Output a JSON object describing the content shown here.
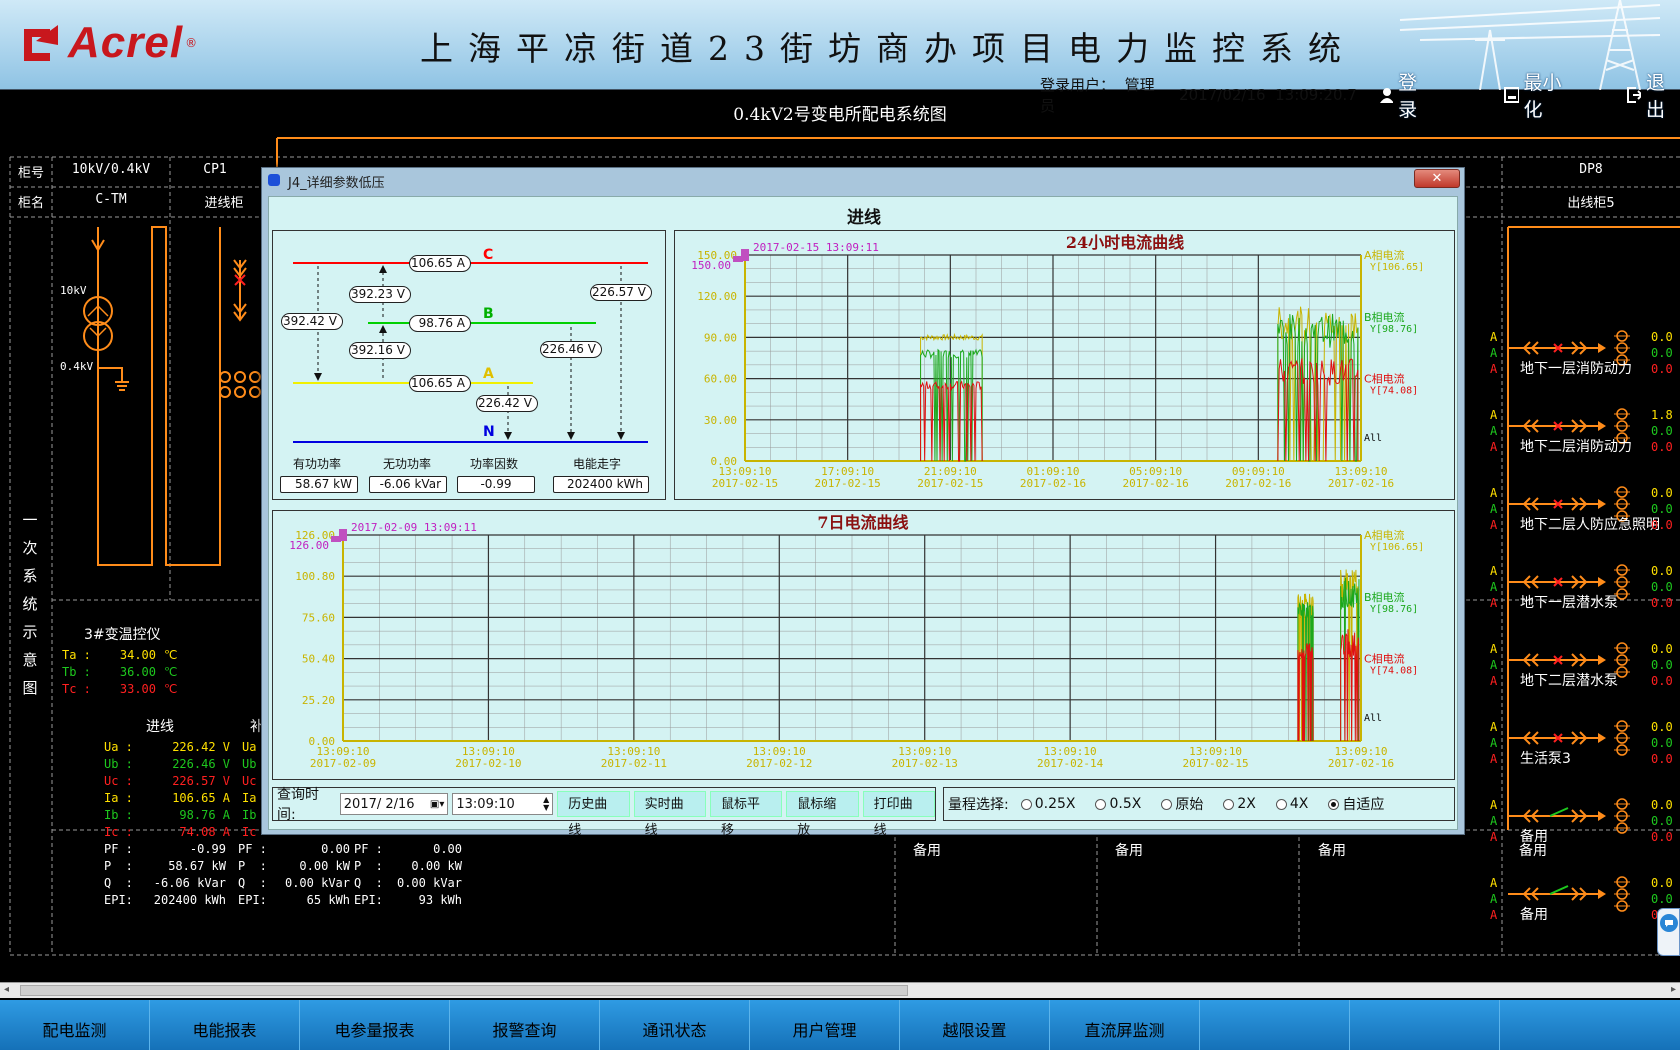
{
  "header": {
    "logo_text": "Acrel",
    "logo_reg": "®",
    "system_title": "上海平凉街道23街坊商办项目电力监控系统",
    "login_user_label": "登录用户：",
    "login_user": "管理员",
    "date": "2017/02/16",
    "time": "13:09:20.7",
    "login_button": "登录",
    "minimize_button": "最小化",
    "exit_button": "退出"
  },
  "page_title": "0.4kV2号变电所配电系统图",
  "table_header": {
    "row1_label": "柜号",
    "row2_label": "柜名",
    "col1_no": "10kV/0.4kV",
    "col1_name": "C-TM",
    "col2_no": "CP1",
    "col2_name": "进线柜",
    "col_last_no": "DP8",
    "col_last_name": "出线柜5"
  },
  "left_side": {
    "vertical_label": "一次系统示意图",
    "transformer_hv": "10kV",
    "transformer_lv": "0.4kV",
    "temp_title": "3#变温控仪",
    "temps": [
      {
        "label": "Ta :",
        "value": "34.00",
        "unit": "℃",
        "color": "#ffe000"
      },
      {
        "label": "Tb :",
        "value": "36.00",
        "unit": "℃",
        "color": "#1ec81e"
      },
      {
        "label": "Tc :",
        "value": "33.00",
        "unit": "℃",
        "color": "#ff2020"
      }
    ],
    "incoming_title": "进线",
    "incoming_title_2": "补",
    "params": [
      {
        "k": "Ua :",
        "v": "226.42 V",
        "k2": "Ua",
        "color": "#ffe000"
      },
      {
        "k": "Ub :",
        "v": "226.46 V",
        "k2": "Ub",
        "color": "#1ec81e"
      },
      {
        "k": "Uc :",
        "v": "226.57 V",
        "k2": "Uc",
        "color": "#ff2020"
      },
      {
        "k": "Ia :",
        "v": "106.65 A",
        "k2": "Ia",
        "color": "#ffe000"
      },
      {
        "k": "Ib :",
        "v": "98.76 A",
        "k2": "Ib",
        "color": "#1ec81e"
      },
      {
        "k": "Ic :",
        "v": "74.08 A",
        "k2": "Ic",
        "color": "#ff2020"
      }
    ],
    "params2": [
      {
        "k": "PF :",
        "v": "-0.99",
        "k2": "PF :",
        "v2": "0.00",
        "k3": "PF :",
        "v3": "0.00"
      },
      {
        "k": "P  :",
        "v": "58.67 kW",
        "k2": "P  :",
        "v2": "0.00 kW",
        "k3": "P  :",
        "v3": "0.00 kW"
      },
      {
        "k": "Q  :",
        "v": "-6.06 kVar",
        "k2": "Q  :",
        "v2": "0.00 kVar",
        "k3": "Q  :",
        "v3": "0.00 kVar"
      },
      {
        "k": "EPI:",
        "v": "202400 kWh",
        "k2": "EPI:",
        "v2": "65 kWh",
        "k3": "EPI:",
        "v3": "93 kWh"
      }
    ]
  },
  "right_feeders": [
    {
      "name": "地下一层消防动力",
      "vals": [
        "0.0",
        "0.0",
        "0.0"
      ]
    },
    {
      "name": "地下二层消防动力",
      "vals": [
        "1.8",
        "0.0",
        "0.0"
      ]
    },
    {
      "name": "地下二层人防应急照明",
      "vals": [
        "0.0",
        "0.0",
        "0.0"
      ]
    },
    {
      "name": "地下一层潜水泵",
      "vals": [
        "0.0",
        "0.0",
        "0.0"
      ]
    },
    {
      "name": "地下二层潜水泵",
      "vals": [
        "0.0",
        "0.0",
        "0.0"
      ]
    },
    {
      "name": "生活泵3",
      "vals": [
        "0.0",
        "0.0",
        "0.0"
      ]
    },
    {
      "name": "备用",
      "vals": [
        "0.0",
        "0.0",
        "0.0"
      ]
    },
    {
      "name": "备用",
      "vals": [
        "0.0",
        "0.0",
        "0.0"
      ]
    }
  ],
  "bottom_spare": [
    "备用",
    "备用",
    "备用",
    "备用"
  ],
  "dialog": {
    "title": "J4_详细参数低压",
    "close": "✕",
    "section_title": "进线",
    "phasor": {
      "phase_c": "C",
      "phase_b": "B",
      "phase_a": "A",
      "phase_n": "N",
      "ic": "106.65",
      "ib": "98.76",
      "ia": "106.65",
      "unit_a": "A",
      "ubc": "392.23",
      "uca": "392.42",
      "uab": "392.16",
      "unit_v": "V",
      "uc": "226.57",
      "ub": "226.46",
      "ua": "226.42",
      "p_label": "有功功率",
      "p_val": "58.67",
      "p_unit": "kW",
      "q_label": "无功功率",
      "q_val": "-6.06",
      "q_unit": "kVar",
      "pf_label": "功率因数",
      "pf_val": "-0.99",
      "e_label": "电能走字",
      "e_val": "202400",
      "e_unit": "kWh"
    },
    "query": {
      "label": "查询时间:",
      "date": "2017/ 2/16",
      "time": "13:09:10",
      "btn_history": "历史曲线",
      "btn_realtime": "实时曲线",
      "btn_pan": "鼠标平移",
      "btn_zoom": "鼠标缩放",
      "btn_print": "打印曲线"
    },
    "range": {
      "label": "量程选择:",
      "options": [
        "0.25X",
        "0.5X",
        "原始",
        "2X",
        "4X",
        "自适应"
      ],
      "selected": "自适应"
    }
  },
  "chart_data": [
    {
      "type": "line",
      "title": "24小时电流曲线",
      "cursor_label": "2017-02-15 13:09:11",
      "cursor_value": "150.00",
      "ylim": [
        0,
        150
      ],
      "y_ticks": [
        "0.00",
        "30.00",
        "60.00",
        "90.00",
        "120.00",
        "150.00"
      ],
      "x_ticks": [
        {
          "t": "13:09:10",
          "d": "2017-02-15"
        },
        {
          "t": "17:09:10",
          "d": "2017-02-15"
        },
        {
          "t": "21:09:10",
          "d": "2017-02-15"
        },
        {
          "t": "01:09:10",
          "d": "2017-02-16"
        },
        {
          "t": "05:09:10",
          "d": "2017-02-16"
        },
        {
          "t": "09:09:10",
          "d": "2017-02-16"
        },
        {
          "t": "13:09:10",
          "d": "2017-02-16"
        }
      ],
      "series": [
        {
          "name": "A相电流",
          "last": "Y[106.65]",
          "color": "#c8b400"
        },
        {
          "name": "B相电流",
          "last": "Y[98.76]",
          "color": "#1ca81c"
        },
        {
          "name": "C相电流",
          "last": "Y[74.08]",
          "color": "#e01010"
        }
      ],
      "all_label": "All"
    },
    {
      "type": "line",
      "title": "7日电流曲线",
      "cursor_label": "2017-02-09 13:09:11",
      "cursor_value": "126.00",
      "ylim": [
        0,
        126
      ],
      "y_ticks": [
        "0.00",
        "25.20",
        "50.40",
        "75.60",
        "100.80",
        "126.00"
      ],
      "x_ticks": [
        {
          "t": "13:09:10",
          "d": "2017-02-09"
        },
        {
          "t": "13:09:10",
          "d": "2017-02-10"
        },
        {
          "t": "13:09:10",
          "d": "2017-02-11"
        },
        {
          "t": "13:09:10",
          "d": "2017-02-12"
        },
        {
          "t": "13:09:10",
          "d": "2017-02-13"
        },
        {
          "t": "13:09:10",
          "d": "2017-02-14"
        },
        {
          "t": "13:09:10",
          "d": "2017-02-15"
        },
        {
          "t": "13:09:10",
          "d": "2017-02-16"
        }
      ],
      "series": [
        {
          "name": "A相电流",
          "last": "Y[106.65]",
          "color": "#c8b400"
        },
        {
          "name": "B相电流",
          "last": "Y[98.76]",
          "color": "#1ca81c"
        },
        {
          "name": "C相电流",
          "last": "Y[74.08]",
          "color": "#e01010"
        }
      ],
      "all_label": "All"
    }
  ],
  "nav": [
    "配电监测",
    "电能报表",
    "电参量报表",
    "报警查询",
    "通讯状态",
    "用户管理",
    "越限设置",
    "直流屏监测",
    "",
    ""
  ]
}
